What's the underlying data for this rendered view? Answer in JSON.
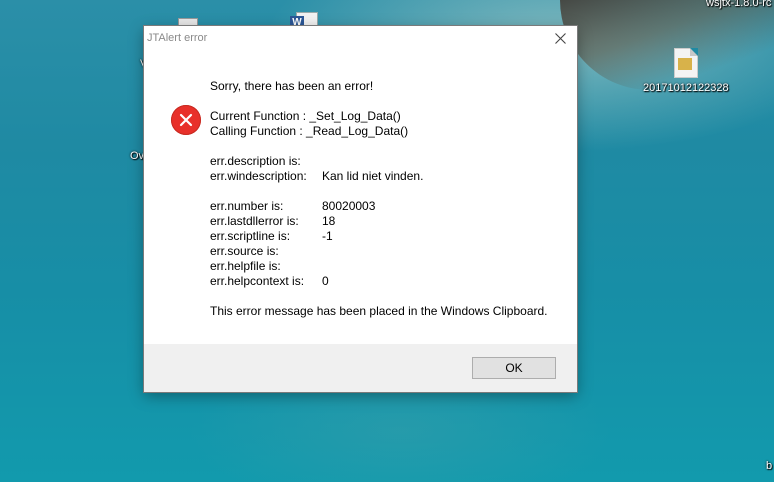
{
  "desktop": {
    "labels": {
      "wsjtx": "wsjtx-1.8.0-rc",
      "image_file": "20171012122328",
      "ov": "Ov",
      "b": "b",
      "v": "V"
    },
    "word_badge": "W",
    "colors": {
      "water": "#1f8aa3"
    }
  },
  "dialog": {
    "title": "JTAlert error",
    "icons": {
      "close": "close-icon",
      "error": "error-icon"
    },
    "headline": "Sorry, there has been an error!",
    "current_function": "Current Function : _Set_Log_Data()",
    "calling_function": "Calling Function : _Read_Log_Data()",
    "fields": [
      {
        "label": "err.description is:",
        "value": ""
      },
      {
        "label": "err.windescription:",
        "value": "Kan lid niet vinden."
      },
      {
        "label": "err.number is:",
        "value": "80020003"
      },
      {
        "label": "err.lastdllerror is:",
        "value": "18"
      },
      {
        "label": "err.scriptline is:",
        "value": "-1"
      },
      {
        "label": "err.source is:",
        "value": ""
      },
      {
        "label": "err.helpfile is:",
        "value": ""
      },
      {
        "label": "err.helpcontext is:",
        "value": "0"
      }
    ],
    "clipboard_note": "This error message has been placed in the Windows Clipboard.",
    "ok_label": "OK",
    "colors": {
      "error_red": "#e8302a",
      "footer_bg": "#f0f0f0"
    }
  }
}
